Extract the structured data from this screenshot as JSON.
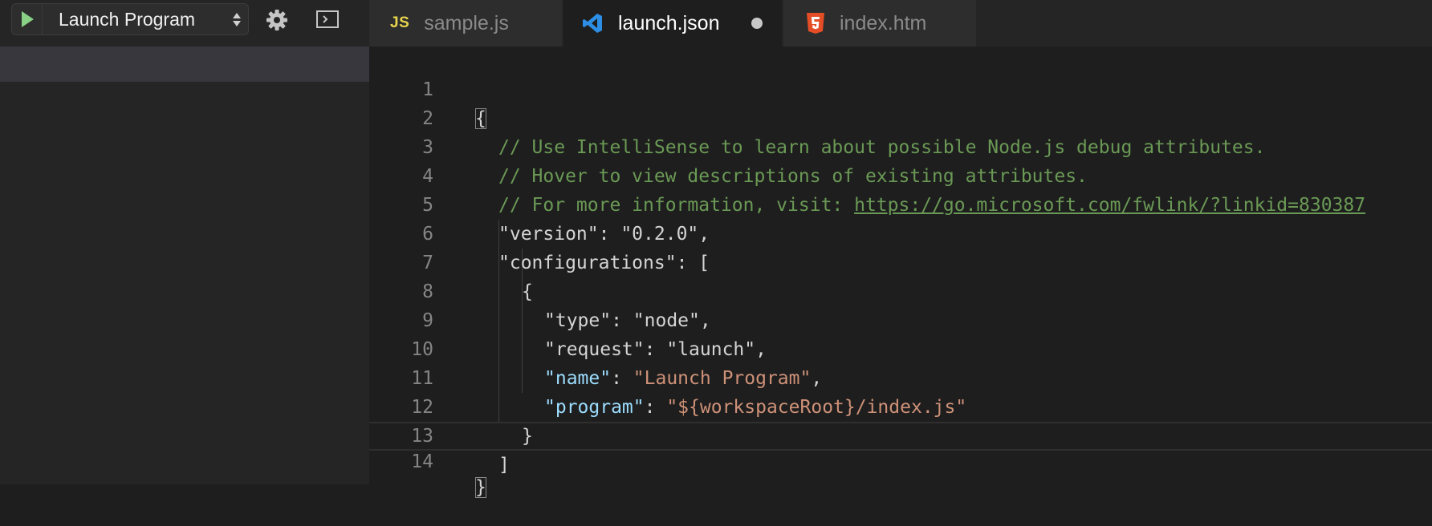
{
  "debug_toolbar": {
    "configuration": "Launch Program",
    "play_icon": "play-icon",
    "gear_icon": "gear-icon",
    "console_icon": "debug-console-icon"
  },
  "tabs": [
    {
      "label": "sample.js",
      "icon": "js-file-icon",
      "icon_text": "JS",
      "active": false
    },
    {
      "label": "launch.json",
      "icon": "vscode-icon",
      "active": true,
      "dirty": true
    },
    {
      "label": "index.htm",
      "icon": "html5-icon",
      "active": false
    }
  ],
  "editor": {
    "line_numbers": [
      "1",
      "2",
      "3",
      "4",
      "5",
      "6",
      "7",
      "8",
      "9",
      "10",
      "11",
      "12",
      "13",
      "14"
    ],
    "lines": {
      "l1": "{",
      "l2": "// Use IntelliSense to learn about possible Node.js debug attributes.",
      "l3": "// Hover to view descriptions of existing attributes.",
      "l4_prefix": "// For more information, visit: ",
      "l4_link": "https://go.microsoft.com/fwlink/?linkid=830387",
      "l5_key": "\"version\"",
      "l5_value": "\"0.2.0\"",
      "l6_key": "\"configurations\"",
      "l6_open": "[",
      "l7": "{",
      "l8_key": "\"type\"",
      "l8_value": "\"node\"",
      "l9_key": "\"request\"",
      "l9_value": "\"launch\"",
      "l10_key": "\"name\"",
      "l10_value": "\"Launch Program\"",
      "l11_key": "\"program\"",
      "l11_value": "\"${workspaceRoot}/index.js\"",
      "l12": "}",
      "l13": "]",
      "l14": "}"
    }
  },
  "colors": {
    "comment": "#6a9955",
    "key_highlight": "#9cdcfe",
    "string_highlight": "#ce9178",
    "play_green": "#89d185",
    "js_yellow": "#e8d44d",
    "vscode_blue": "#2d8ee6",
    "html_orange": "#e44d26"
  }
}
